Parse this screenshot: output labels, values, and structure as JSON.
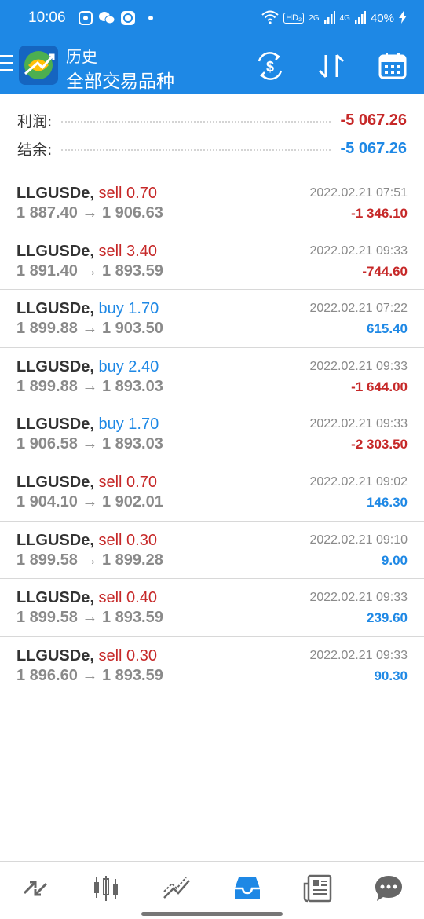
{
  "status_bar": {
    "time": "10:06",
    "network_left": "HD₂",
    "network_2g": "2G",
    "network_4g": "4G",
    "battery": "40%"
  },
  "app_bar": {
    "title": "历史",
    "subtitle": "全部交易品种",
    "actions": [
      "currency-exchange-icon",
      "sort-icon",
      "calendar-icon"
    ]
  },
  "summary": {
    "profit_label": "利润:",
    "profit_value": "-5 067.26",
    "balance_label": "结余:",
    "balance_value": "-5 067.26"
  },
  "trades": [
    {
      "symbol": "LLGUSDe,",
      "side": "sell 0.70",
      "prices": "1 887.40 → 1 906.63",
      "date": "2022.02.21 07:51",
      "profit": "-1 346.10"
    },
    {
      "symbol": "LLGUSDe,",
      "side": "sell 3.40",
      "prices": "1 891.40 → 1 893.59",
      "date": "2022.02.21 09:33",
      "profit": "-744.60"
    },
    {
      "symbol": "LLGUSDe,",
      "side": "buy 1.70",
      "prices": "1 899.88 → 1 903.50",
      "date": "2022.02.21 07:22",
      "profit": "615.40"
    },
    {
      "symbol": "LLGUSDe,",
      "side": "buy 2.40",
      "prices": "1 899.88 → 1 893.03",
      "date": "2022.02.21 09:33",
      "profit": "-1 644.00"
    },
    {
      "symbol": "LLGUSDe,",
      "side": "buy 1.70",
      "prices": "1 906.58 → 1 893.03",
      "date": "2022.02.21 09:33",
      "profit": "-2 303.50"
    },
    {
      "symbol": "LLGUSDe,",
      "side": "sell 0.70",
      "prices": "1 904.10 → 1 902.01",
      "date": "2022.02.21 09:02",
      "profit": "146.30"
    },
    {
      "symbol": "LLGUSDe,",
      "side": "sell 0.30",
      "prices": "1 899.58 → 1 899.28",
      "date": "2022.02.21 09:10",
      "profit": "9.00"
    },
    {
      "symbol": "LLGUSDe,",
      "side": "sell 0.40",
      "prices": "1 899.58 → 1 893.59",
      "date": "2022.02.21 09:33",
      "profit": "239.60"
    },
    {
      "symbol": "LLGUSDe,",
      "side": "sell 0.30",
      "prices": "1 896.60 → 1 893.59",
      "date": "2022.02.21 09:33",
      "profit": "90.30"
    }
  ],
  "bottom_nav": [
    "quotes-icon",
    "chart-icon",
    "trade-icon",
    "history-icon",
    "news-icon",
    "messages-icon"
  ],
  "colors": {
    "primary": "#1e88e5",
    "negative": "#c62828",
    "positive": "#1e88e5"
  }
}
